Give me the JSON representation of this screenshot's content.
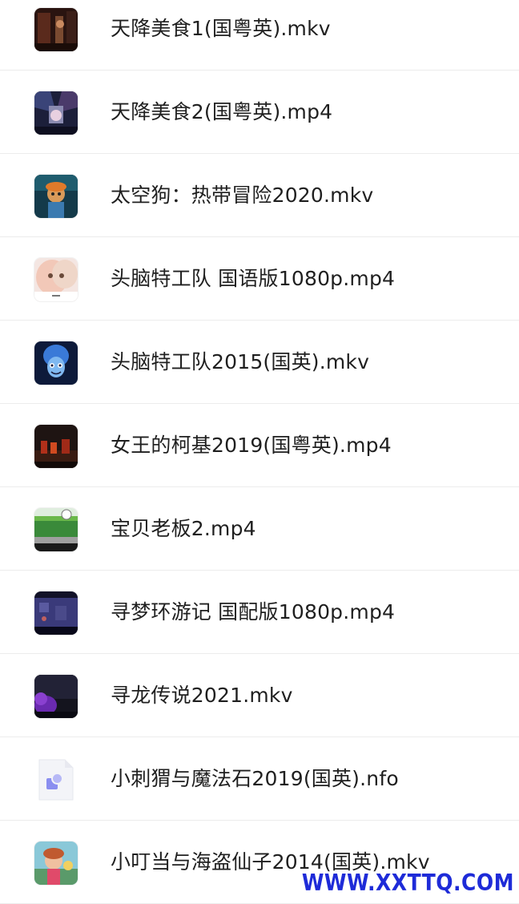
{
  "files": [
    {
      "name": "天降美食1(国粤英).mkv",
      "thumb": "video-thumbnail"
    },
    {
      "name": "天降美食2(国粤英).mp4",
      "thumb": "video-thumbnail"
    },
    {
      "name": "太空狗：热带冒险2020.mkv",
      "thumb": "video-thumbnail"
    },
    {
      "name": "头脑特工队 国语版1080p.mp4",
      "thumb": "video-thumbnail"
    },
    {
      "name": "头脑特工队2015(国英).mkv",
      "thumb": "video-thumbnail"
    },
    {
      "name": "女王的柯基2019(国粤英).mp4",
      "thumb": "video-thumbnail"
    },
    {
      "name": "宝贝老板2.mp4",
      "thumb": "video-thumbnail"
    },
    {
      "name": "寻梦环游记 国配版1080p.mp4",
      "thumb": "video-thumbnail"
    },
    {
      "name": "寻龙传说2021.mkv",
      "thumb": "video-thumbnail"
    },
    {
      "name": "小刺猬与魔法石2019(国英).nfo",
      "thumb": "document-file-icon"
    },
    {
      "name": "小叮当与海盗仙子2014(国英).mkv",
      "thumb": "video-thumbnail"
    }
  ],
  "watermark": "WWW.XXTTQ.COM"
}
